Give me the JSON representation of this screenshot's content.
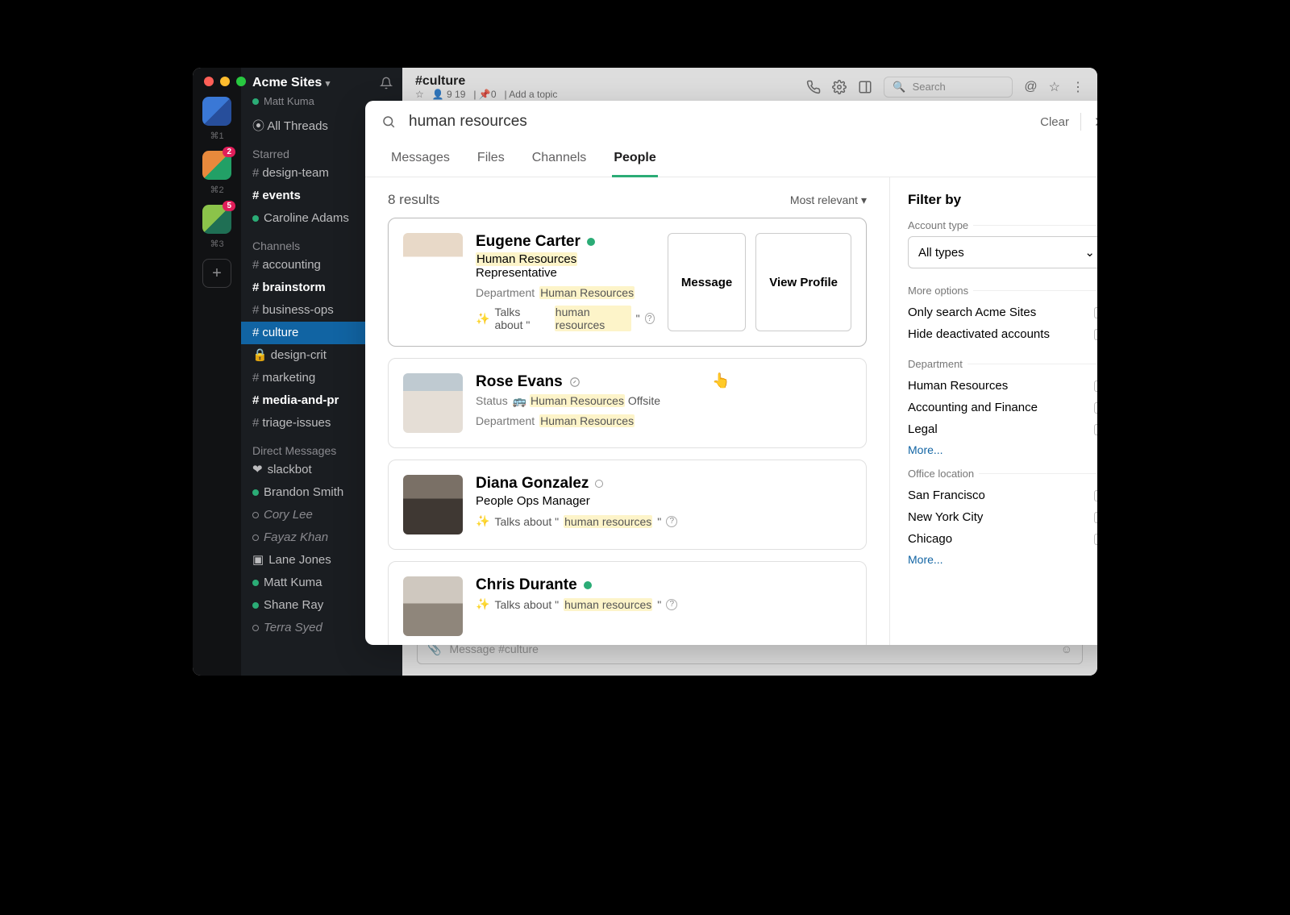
{
  "workspace": {
    "name": "Acme Sites",
    "user": "Matt Kuma"
  },
  "rail": {
    "shortcuts": [
      "⌘1",
      "⌘2",
      "⌘3"
    ],
    "badges": {
      "ws2": "2",
      "ws3": "5"
    }
  },
  "sidebar": {
    "all_threads": "All Threads",
    "sections": {
      "starred": "Starred",
      "channels": "Channels",
      "dms": "Direct Messages"
    },
    "starred": [
      {
        "prefix": "#",
        "label": "design-team",
        "bold": false
      },
      {
        "prefix": "#",
        "label": "events",
        "bold": true
      },
      {
        "prefix": "",
        "label": "Caroline Adams",
        "bold": false,
        "dm": true
      }
    ],
    "channels": [
      {
        "prefix": "#",
        "label": "accounting",
        "bold": false
      },
      {
        "prefix": "#",
        "label": "brainstorm",
        "bold": true
      },
      {
        "prefix": "#",
        "label": "business-ops",
        "bold": false
      },
      {
        "prefix": "#",
        "label": "culture",
        "bold": false,
        "selected": true
      },
      {
        "prefix": "🔒",
        "label": "design-crit",
        "bold": false
      },
      {
        "prefix": "#",
        "label": "marketing",
        "bold": false
      },
      {
        "prefix": "#",
        "label": "media-and-pr",
        "bold": true
      },
      {
        "prefix": "#",
        "label": "triage-issues",
        "bold": false
      }
    ],
    "dms": [
      {
        "pre": "❤",
        "label": "slackbot",
        "italic": false
      },
      {
        "pre": "●",
        "label": "Brandon Smith"
      },
      {
        "pre": "○",
        "label": "Cory Lee",
        "italic": true
      },
      {
        "pre": "○",
        "label": "Fayaz Khan",
        "italic": true
      },
      {
        "pre": "▣",
        "label": "Lane Jones"
      },
      {
        "pre": "●",
        "label": "Matt Kuma"
      },
      {
        "pre": "●",
        "label": "Shane Ray"
      },
      {
        "pre": "○",
        "label": "Terra Syed",
        "italic": true
      }
    ]
  },
  "channel": {
    "name": "#culture",
    "members": "9 19",
    "pins": "0",
    "add_topic": "Add a topic",
    "search_ph": "Search",
    "msg_ph": "Message #culture"
  },
  "search": {
    "query": "human resources",
    "clear": "Clear",
    "tabs": [
      "Messages",
      "Files",
      "Channels",
      "People"
    ],
    "active_tab": 3,
    "count": "8 results",
    "sort": "Most relevant"
  },
  "results": [
    {
      "name": "Eugene Carter",
      "presence": "on",
      "role_pre_hl": "Human Resources",
      "role_post": " Representative",
      "dept_label": "Department",
      "dept_hl": "Human Resources",
      "talks_pre": "Talks about \"",
      "talks_hl": "human resources",
      "talks_post": "\"",
      "btn_msg": "Message",
      "btn_view": "View Profile"
    },
    {
      "name": "Rose Evans",
      "presence": "away-icon",
      "status_label": "Status",
      "status_emoji": "🚌",
      "status_hl": "Human Resources",
      "status_post": " Offsite",
      "dept_label": "Department",
      "dept_hl": "Human Resources"
    },
    {
      "name": "Diana Gonzalez",
      "presence": "off",
      "role_plain": "People Ops Manager",
      "talks_pre": "Talks about \"",
      "talks_hl": "human resources",
      "talks_post": "\""
    },
    {
      "name": "Chris Durante",
      "presence": "on",
      "talks_pre": "Talks about \"",
      "talks_hl": "human resources",
      "talks_post": "\""
    }
  ],
  "filters": {
    "title": "Filter by",
    "account_label": "Account type",
    "account_value": "All types",
    "more_label": "More options",
    "opt_only": "Only search Acme Sites",
    "opt_hide": "Hide deactivated accounts",
    "dept_label": "Department",
    "depts": [
      "Human Resources",
      "Accounting and Finance",
      "Legal"
    ],
    "loc_label": "Office location",
    "locs": [
      "San Francisco",
      "New York City",
      "Chicago"
    ],
    "more": "More..."
  }
}
